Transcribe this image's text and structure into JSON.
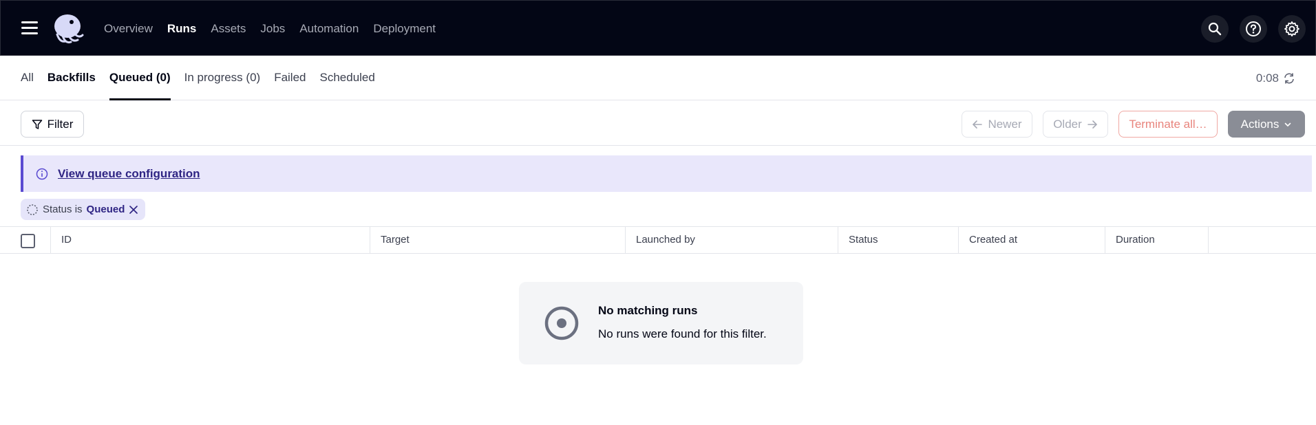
{
  "nav": {
    "links": [
      {
        "label": "Overview"
      },
      {
        "label": "Runs"
      },
      {
        "label": "Assets"
      },
      {
        "label": "Jobs"
      },
      {
        "label": "Automation"
      },
      {
        "label": "Deployment"
      }
    ],
    "active": "Runs",
    "icons": [
      "search-icon",
      "help-icon",
      "gear-icon"
    ]
  },
  "tabs": [
    {
      "label": "All"
    },
    {
      "label": "Backfills"
    },
    {
      "label": "Queued (0)"
    },
    {
      "label": "In progress (0)"
    },
    {
      "label": "Failed"
    },
    {
      "label": "Scheduled"
    }
  ],
  "selected_tab": "Queued (0)",
  "refresh": {
    "timer": "0:08"
  },
  "toolbar": {
    "filter_label": "Filter",
    "newer_label": "Newer",
    "older_label": "Older",
    "terminate_label": "Terminate all…",
    "actions_label": "Actions"
  },
  "banner": {
    "link": "View queue configuration"
  },
  "filter_chip": {
    "prefix": "Status is",
    "value": "Queued"
  },
  "table": {
    "columns": [
      "ID",
      "Target",
      "Launched by",
      "Status",
      "Created at",
      "Duration"
    ]
  },
  "empty_state": {
    "title": "No matching runs",
    "message": "No runs were found for this filter."
  },
  "colors": {
    "nav_bg": "#030615",
    "banner_bg": "#e9e7fb",
    "banner_accent": "#5a4bd1",
    "terminate": "#e8847c",
    "actions_bg": "#8a8d96"
  }
}
